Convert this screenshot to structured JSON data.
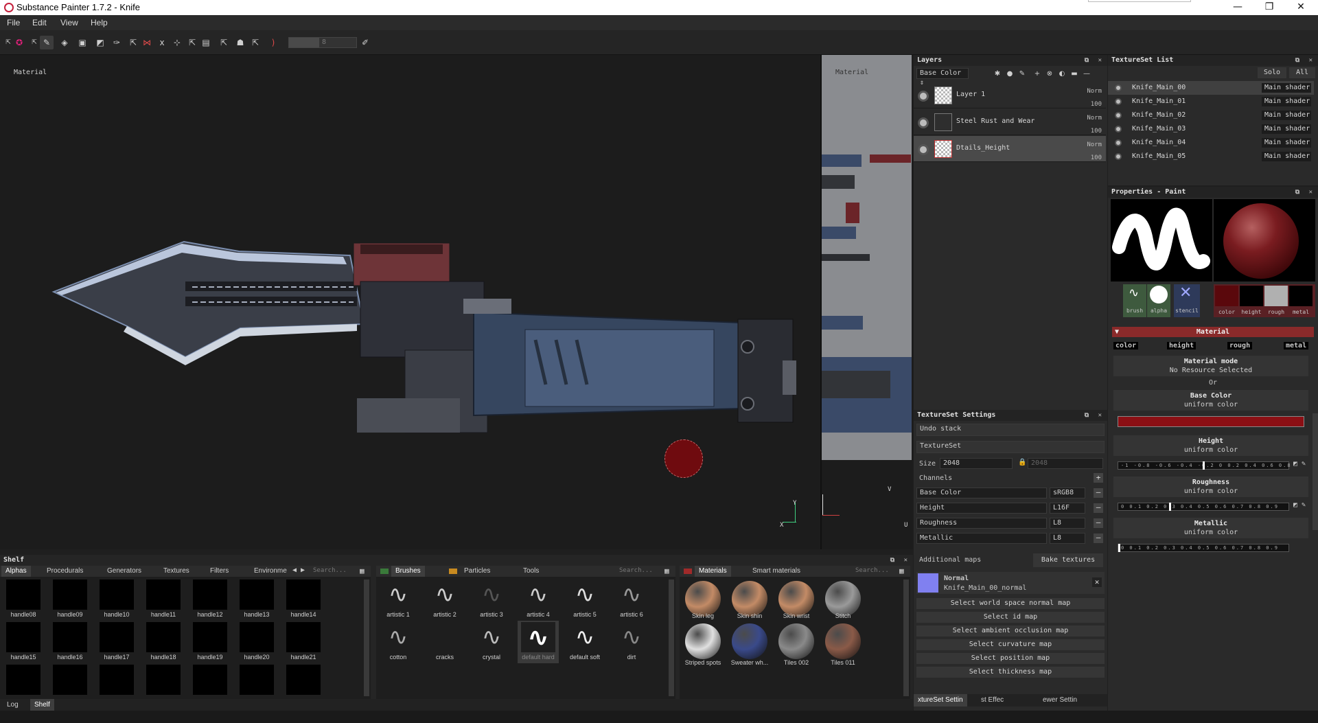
{
  "window": {
    "title": "Substance Painter 1.7.2 - Knife",
    "minimize": "—",
    "restore": "❐",
    "close": "✕"
  },
  "menu": [
    "File",
    "Edit",
    "View",
    "Help"
  ],
  "toolbar": {
    "brush_size_value": "8"
  },
  "viewport": {
    "label_3d": "Material",
    "label_2d": "Material",
    "axis_y": "Y",
    "axis_x": "X",
    "axis_v": "V",
    "axis_u": "U"
  },
  "layers": {
    "title": "Layers",
    "channel_select": "Base Color",
    "rows": [
      {
        "name": "Layer 1",
        "blend": "Norm",
        "opacity": "100"
      },
      {
        "name": "Steel Rust and Wear",
        "blend": "Norm",
        "opacity": "100"
      },
      {
        "name": "Dtails_Height",
        "blend": "Norm",
        "opacity": "100"
      }
    ]
  },
  "textureset_list": {
    "title": "TextureSet List",
    "solo": "Solo",
    "all": "All",
    "items": [
      {
        "name": "Knife_Main_00",
        "shader": "Main shader"
      },
      {
        "name": "Knife_Main_01",
        "shader": "Main shader"
      },
      {
        "name": "Knife_Main_02",
        "shader": "Main shader"
      },
      {
        "name": "Knife_Main_03",
        "shader": "Main shader"
      },
      {
        "name": "Knife_Main_04",
        "shader": "Main shader"
      },
      {
        "name": "Knife_Main_05",
        "shader": "Main shader"
      }
    ]
  },
  "properties": {
    "title": "Properties - Paint",
    "thumb_labels": [
      "brush",
      "alpha",
      "stencil"
    ],
    "channel_labels": [
      "color",
      "height",
      "rough",
      "metal"
    ],
    "material_header": "Material",
    "material_tabs": [
      "color",
      "height",
      "rough",
      "metal"
    ],
    "material_mode": "Material mode",
    "no_resource": "No Resource Selected",
    "or": "Or",
    "base_color": "Base Color",
    "uniform_color": "uniform color",
    "base_color_hex": "#8b0f14",
    "height": "Height",
    "roughness": "Roughness",
    "metallic": "Metallic",
    "height_ticks": "-1 -0.8 -0.6 -0.4 -0.2 0 0.2 0.4 0.6 0.8",
    "unit_ticks": "0 0.1 0.2 0.3 0.4 0.5 0.6 0.7 0.8 0.9",
    "height_value": 0.0,
    "roughness_value": 0.3,
    "metallic_value": 0.0
  },
  "textureset_settings": {
    "title": "TextureSet Settings",
    "undo_stack": "Undo stack",
    "textureset": "TextureSet",
    "size_label": "Size",
    "size_value": "2048",
    "size_value2": "2048",
    "channels_label": "Channels",
    "channels": [
      {
        "name": "Base Color",
        "format": "sRGB8"
      },
      {
        "name": "Height",
        "format": "L16F"
      },
      {
        "name": "Roughness",
        "format": "L8"
      },
      {
        "name": "Metallic",
        "format": "L8"
      }
    ],
    "additional_maps": "Additional maps",
    "bake_textures": "Bake textures",
    "normal_title": "Normal",
    "normal_map": "Knife_Main_00_normal",
    "map_buttons": [
      "Select world space normal map",
      "Select id map",
      "Select ambient occlusion map",
      "Select curvature map",
      "Select position map",
      "Select thickness map"
    ],
    "bottom_tabs": [
      "xtureSet Settin",
      "st Effec",
      "ewer Settin"
    ]
  },
  "shelf": {
    "title": "Shelf",
    "alpha_tabs": [
      "Alphas",
      "Procedurals",
      "Generators",
      "Textures",
      "Filters",
      "Environme"
    ],
    "search": "Search...",
    "alpha_rows": [
      [
        "handle08",
        "handle09",
        "handle10",
        "handle11",
        "handle12",
        "handle13",
        "handle14"
      ],
      [
        "handle15",
        "handle16",
        "handle17",
        "handle18",
        "handle19",
        "handle20",
        "handle21"
      ]
    ],
    "brush_tabs": [
      "Brushes",
      "Particles",
      "Tools"
    ],
    "brush_rows": [
      [
        "artistic 1",
        "artistic 2",
        "artistic 3",
        "artistic 4",
        "artistic 5",
        "artistic 6"
      ],
      [
        "cotton",
        "cracks",
        "crystal",
        "default hard",
        "default soft",
        "dirt"
      ]
    ],
    "material_tabs": [
      "Materials",
      "Smart materials"
    ],
    "material_rows": [
      [
        "Skin leg",
        "Skin shin",
        "Skin wrist",
        "Stitch"
      ],
      [
        "Striped spots",
        "Sweater wh...",
        "Tiles 002",
        "Tiles 011"
      ]
    ],
    "material_colors": [
      "#c38b66",
      "#c38b66",
      "#c38b66",
      "#9a9a9a",
      "#e0e0e0",
      "#3a4a8a",
      "#8a8a8a",
      "#8a5a48"
    ],
    "bottom_tabs": [
      "Log",
      "Shelf"
    ]
  }
}
